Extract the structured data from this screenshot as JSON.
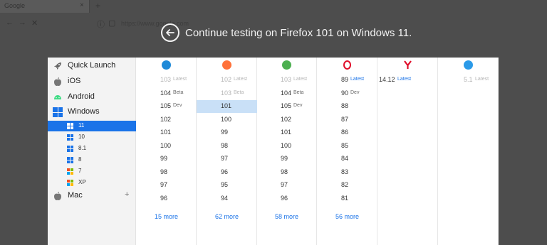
{
  "browser_chrome": {
    "tab_title": "Google",
    "tab_close": "×",
    "new_tab": "+",
    "url_text": "https://www.google.com"
  },
  "overlay": {
    "headline": "Continue testing on Firefox 101 on Windows 11."
  },
  "sidebar": {
    "items": [
      {
        "label": "Quick Launch",
        "icon": "rocket-icon"
      },
      {
        "label": "iOS",
        "icon": "apple-icon"
      },
      {
        "label": "Android",
        "icon": "android-icon"
      },
      {
        "label": "Windows",
        "icon": "windows-icon"
      }
    ],
    "windows_versions": [
      {
        "label": "11",
        "active": true
      },
      {
        "label": "10"
      },
      {
        "label": "8.1"
      },
      {
        "label": "8"
      },
      {
        "label": "7"
      },
      {
        "label": "XP"
      }
    ],
    "mac": {
      "label": "Mac",
      "expand": "+"
    }
  },
  "browsers": [
    {
      "name": "edge-icon",
      "color": "#1f8ad8",
      "versions": [
        {
          "num": "103",
          "tag": "Latest",
          "state": "faded"
        },
        {
          "num": "104",
          "tag": "Beta"
        },
        {
          "num": "105",
          "tag": "Dev"
        },
        {
          "num": "102"
        },
        {
          "num": "101"
        },
        {
          "num": "100"
        },
        {
          "num": "99"
        },
        {
          "num": "98"
        },
        {
          "num": "97"
        },
        {
          "num": "96"
        }
      ],
      "more": "15 more"
    },
    {
      "name": "firefox-icon",
      "color": "#ff7139",
      "versions": [
        {
          "num": "102",
          "tag": "Latest",
          "state": "faded"
        },
        {
          "num": "103",
          "tag": "Beta",
          "state": "faded"
        },
        {
          "num": "101",
          "state": "selected"
        },
        {
          "num": "100"
        },
        {
          "num": "99"
        },
        {
          "num": "98"
        },
        {
          "num": "97"
        },
        {
          "num": "96"
        },
        {
          "num": "95"
        },
        {
          "num": "94"
        }
      ],
      "more": "62 more"
    },
    {
      "name": "chrome-icon",
      "color": "#4caf50",
      "versions": [
        {
          "num": "103",
          "tag": "Latest",
          "state": "faded"
        },
        {
          "num": "104",
          "tag": "Beta"
        },
        {
          "num": "105",
          "tag": "Dev"
        },
        {
          "num": "102"
        },
        {
          "num": "101"
        },
        {
          "num": "100"
        },
        {
          "num": "99"
        },
        {
          "num": "98"
        },
        {
          "num": "97"
        },
        {
          "num": "96"
        }
      ],
      "more": "58 more"
    },
    {
      "name": "opera-icon",
      "color": "#e0102b",
      "versions": [
        {
          "num": "89",
          "tag": "Latest",
          "state": "latest"
        },
        {
          "num": "90",
          "tag": "Dev"
        },
        {
          "num": "88"
        },
        {
          "num": "87"
        },
        {
          "num": "86"
        },
        {
          "num": "85"
        },
        {
          "num": "84"
        },
        {
          "num": "83"
        },
        {
          "num": "82"
        },
        {
          "num": "81"
        }
      ],
      "more": "56 more"
    },
    {
      "name": "yandex-icon",
      "color": "#e0102b",
      "versions": [
        {
          "num": "14.12",
          "tag": "Latest",
          "state": "latest"
        }
      ],
      "more": ""
    },
    {
      "name": "safari-icon",
      "color": "#2b9ae8",
      "versions": [
        {
          "num": "5.1",
          "tag": "Latest",
          "state": "faded"
        }
      ],
      "more": ""
    }
  ]
}
